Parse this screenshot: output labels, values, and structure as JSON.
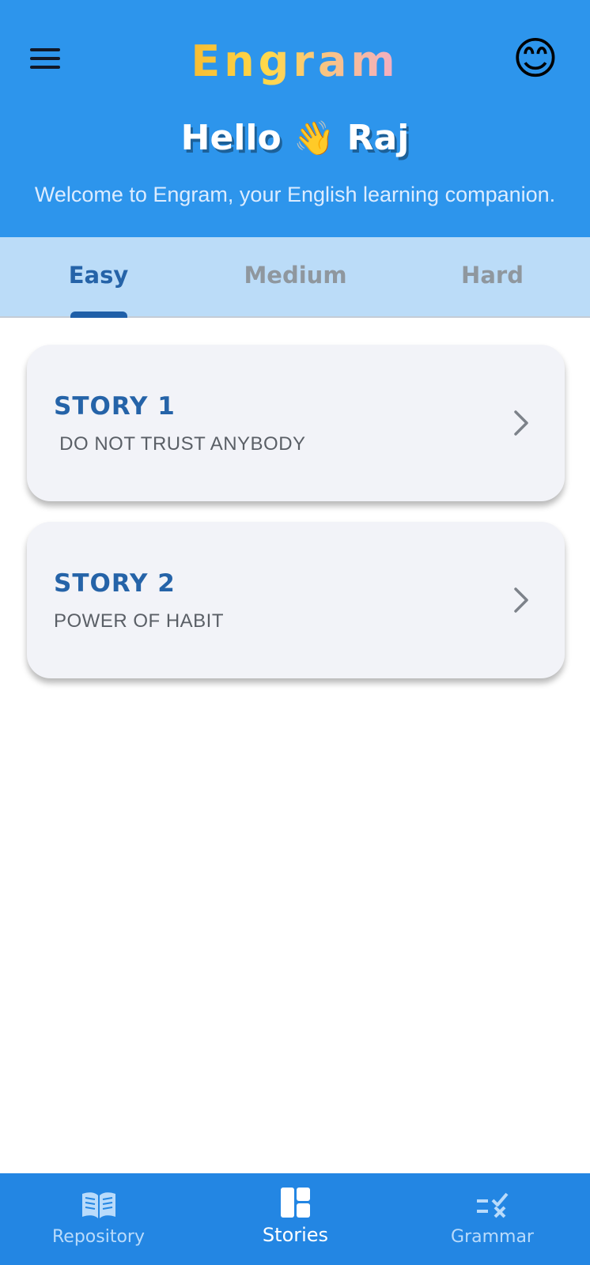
{
  "header": {
    "menu_icon": "menu-icon",
    "app_title": "Engram",
    "avatar_emoji": "😊",
    "greeting_prefix": "Hello",
    "greeting_wave": "👋",
    "greeting_name": "Raj",
    "welcome_text": "Welcome to Engram, your English learning companion."
  },
  "tabs": [
    {
      "label": "Easy",
      "active": true
    },
    {
      "label": "Medium",
      "active": false
    },
    {
      "label": "Hard",
      "active": false
    }
  ],
  "stories": [
    {
      "title": "STORY 1",
      "subtitle": " DO NOT TRUST ANYBODY"
    },
    {
      "title": "STORY 2",
      "subtitle": "POWER OF HABIT"
    }
  ],
  "bottom_nav": [
    {
      "label": "Repository",
      "icon": "book-icon",
      "active": false
    },
    {
      "label": "Stories",
      "icon": "dashboard-icon",
      "active": true
    },
    {
      "label": "Grammar",
      "icon": "rule-icon",
      "active": false
    }
  ],
  "colors": {
    "header_bg": "#2d95ec",
    "tab_bar_bg": "#bbdcf8",
    "accent": "#2563a8",
    "card_bg": "#f2f3f8",
    "bottom_nav_bg": "#2386e3"
  }
}
